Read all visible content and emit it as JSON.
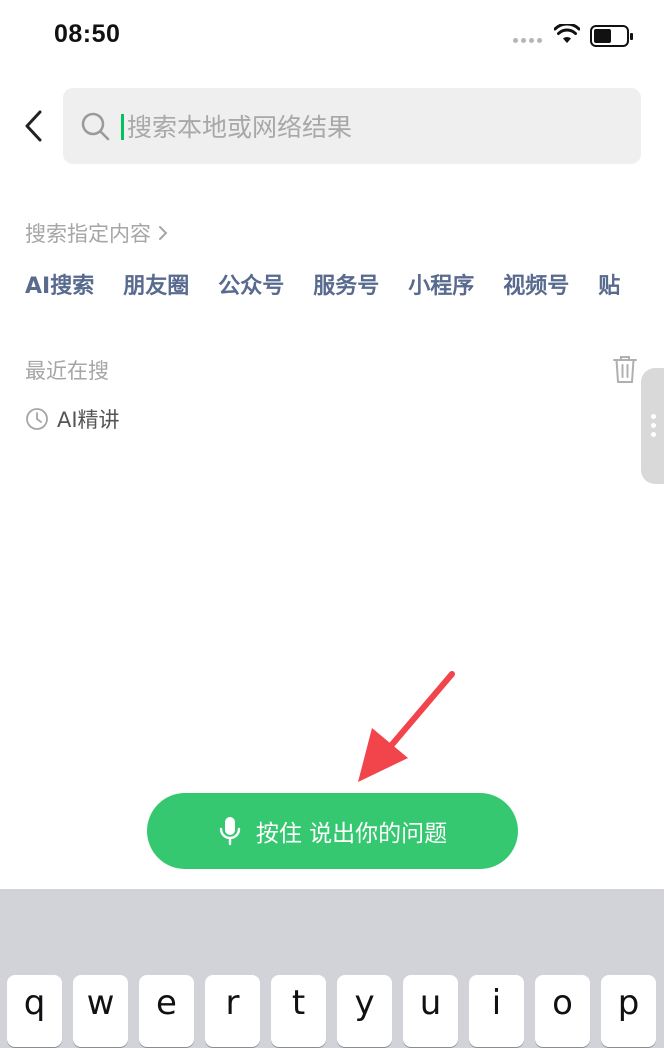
{
  "status_bar": {
    "time": "08:50"
  },
  "search": {
    "placeholder": "搜索本地或网络结果",
    "value": ""
  },
  "search_specific": {
    "title": "搜索指定内容",
    "categories": [
      "AI搜索",
      "朋友圈",
      "公众号",
      "服务号",
      "小程序",
      "视频号",
      "贴"
    ]
  },
  "recent": {
    "title": "最近在搜",
    "items": [
      "AI精讲"
    ]
  },
  "voice_button": {
    "label": "按住 说出你的问题"
  },
  "keyboard": {
    "row1": [
      "q",
      "w",
      "e",
      "r",
      "t",
      "y",
      "u",
      "i",
      "o",
      "p"
    ]
  },
  "colors": {
    "accent_green": "#36c870",
    "category_text": "#586a8e",
    "arrow_red": "#f2444b",
    "keyboard_bg": "#d1d3d9"
  }
}
